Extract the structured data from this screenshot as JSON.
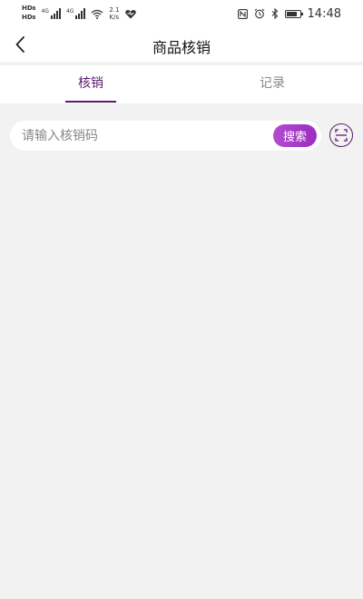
{
  "status_bar": {
    "hd1": "HD",
    "hd1_sub": "B",
    "hd2": "HD",
    "hd2_sub": "B",
    "net1": "4G",
    "net2": "4G",
    "speed_value": "2.1",
    "speed_unit": "K/s",
    "time": "14:48",
    "battery_level_percent": 80
  },
  "header": {
    "title": "商品核销"
  },
  "tabs": [
    {
      "label": "核销",
      "active": true
    },
    {
      "label": "记录",
      "active": false
    }
  ],
  "search": {
    "placeholder": "请输入核销码",
    "value": "",
    "button_label": "搜索"
  },
  "colors": {
    "accent": "#5a1b6e",
    "button_gradient_start": "#b44ad1",
    "button_gradient_end": "#9a2fbf",
    "background": "#f2f2f2"
  },
  "icons": {
    "back": "chevron-left-icon",
    "scan": "scan-icon"
  }
}
